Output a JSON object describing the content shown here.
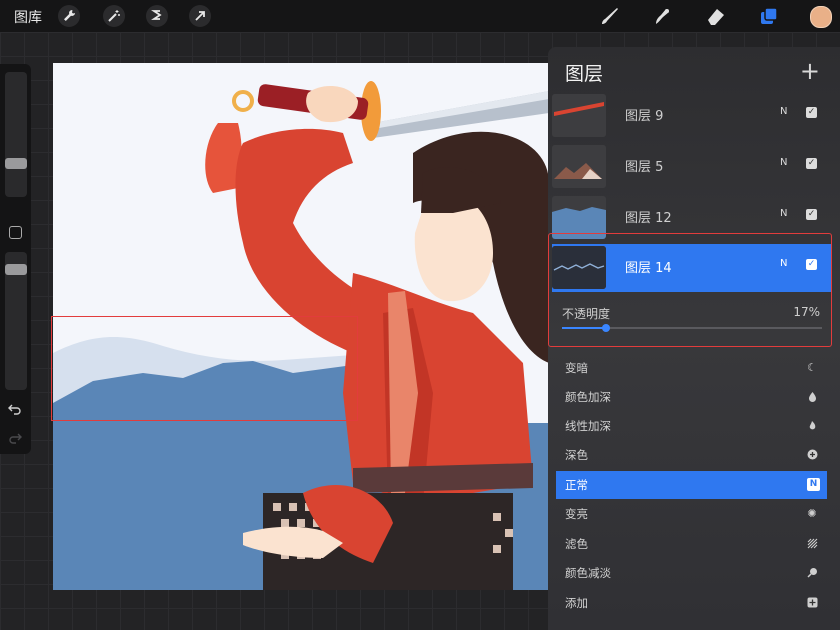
{
  "topbar": {
    "gallery_label": "图库",
    "tools_left": [
      "wrench-icon",
      "magic-wand-icon",
      "selection-icon",
      "transform-arrow-icon"
    ],
    "tools_right": [
      "brush-icon",
      "smudge-icon",
      "eraser-icon",
      "layers-icon"
    ],
    "color": "#e9b088"
  },
  "panel": {
    "title": "图层",
    "add_label": "+",
    "layers": [
      {
        "name": "图层 9",
        "mode": "N",
        "visible": true,
        "active": false
      },
      {
        "name": "图层 5",
        "mode": "N",
        "visible": true,
        "active": false
      },
      {
        "name": "图层 12",
        "mode": "N",
        "visible": true,
        "active": false
      },
      {
        "name": "图层 14",
        "mode": "N",
        "visible": true,
        "active": true
      }
    ],
    "opacity_label": "不透明度",
    "opacity_value": "17%",
    "opacity_fraction": 0.17,
    "blend_modes": [
      {
        "name": "变暗",
        "icon": "moon-icon"
      },
      {
        "name": "颜色加深",
        "icon": "burn-icon"
      },
      {
        "name": "线性加深",
        "icon": "flame-icon"
      },
      {
        "name": "深色",
        "icon": "plus-circle-icon"
      },
      {
        "name": "正常",
        "icon": "normal-n-icon",
        "active": true,
        "badge": "N"
      },
      {
        "name": "变亮",
        "icon": "sun-icon"
      },
      {
        "name": "滤色",
        "icon": "hatch-icon"
      },
      {
        "name": "颜色减淡",
        "icon": "dodge-icon"
      },
      {
        "name": "添加",
        "icon": "plus-square-icon"
      }
    ]
  },
  "colors": {
    "accent": "#2f78f0",
    "highlight": "#e23c3c"
  }
}
